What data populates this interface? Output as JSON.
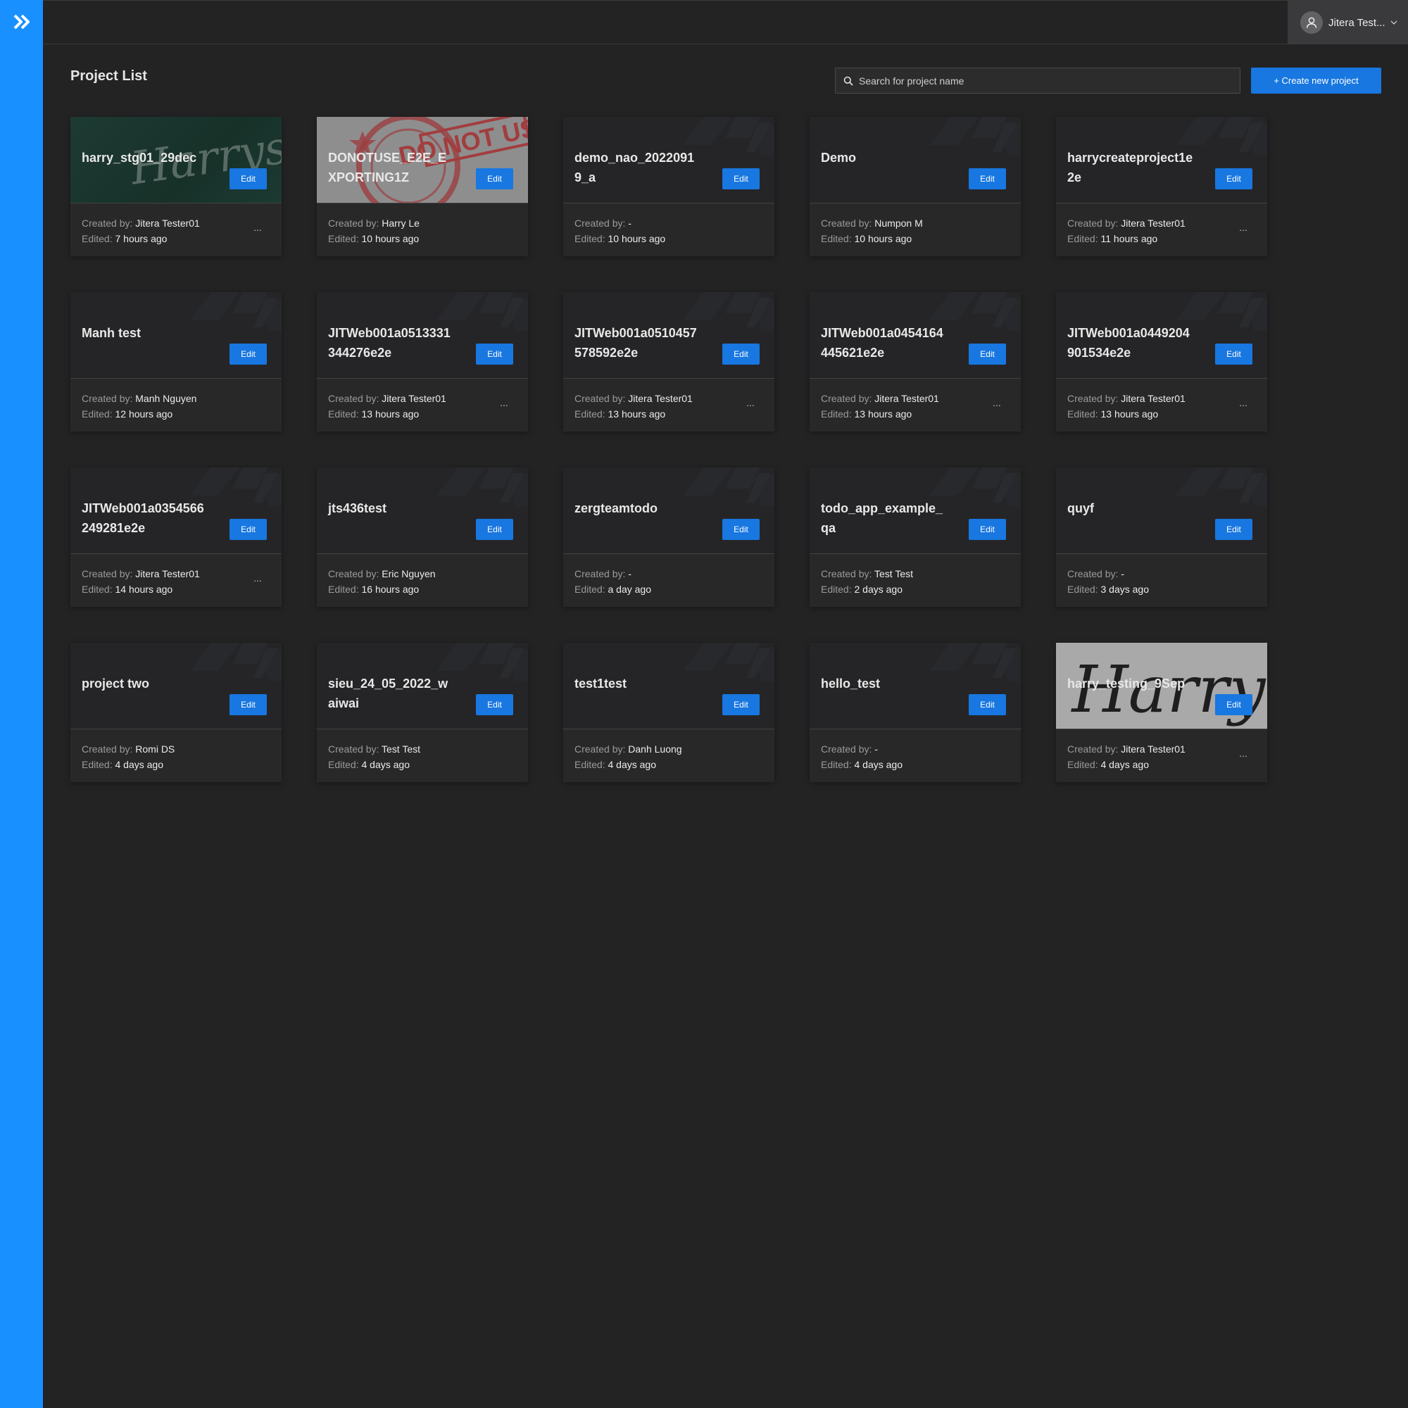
{
  "header": {
    "user_name": "Jitera Test...",
    "accent": "#1890ff"
  },
  "main": {
    "title": "Project List",
    "search_placeholder": "Search for project name",
    "create_label": "+ Create new project"
  },
  "card_labels": {
    "created_by": "Created by:",
    "edited": "Edited:",
    "edit": "Edit",
    "more": "..."
  },
  "projects": [
    {
      "name": "harry_stg01_29dec",
      "created_by": "Jitera Tester01",
      "edited": "7 hours ago",
      "more": true,
      "image": "harrys"
    },
    {
      "name": "DONOTUSE_E2E_EXPORTING1Z",
      "created_by": "Harry Le",
      "edited": "10 hours ago",
      "more": false,
      "image": "donotuse"
    },
    {
      "name": "demo_nao_20220919_a",
      "created_by": "-",
      "edited": "10 hours ago",
      "more": false,
      "image": ""
    },
    {
      "name": "Demo",
      "created_by": "Numpon M",
      "edited": "10 hours ago",
      "more": false,
      "image": ""
    },
    {
      "name": "harrycreateproject1e2e",
      "created_by": "Jitera Tester01",
      "edited": "11 hours ago",
      "more": true,
      "image": ""
    },
    {
      "name": "Manh test",
      "created_by": "Manh Nguyen",
      "edited": "12 hours ago",
      "more": false,
      "image": ""
    },
    {
      "name": "JITWeb001a0513331344276e2e",
      "created_by": "Jitera Tester01",
      "edited": "13 hours ago",
      "more": true,
      "image": ""
    },
    {
      "name": "JITWeb001a0510457578592e2e",
      "created_by": "Jitera Tester01",
      "edited": "13 hours ago",
      "more": true,
      "image": ""
    },
    {
      "name": "JITWeb001a0454164445621e2e",
      "created_by": "Jitera Tester01",
      "edited": "13 hours ago",
      "more": true,
      "image": ""
    },
    {
      "name": "JITWeb001a0449204901534e2e",
      "created_by": "Jitera Tester01",
      "edited": "13 hours ago",
      "more": true,
      "image": ""
    },
    {
      "name": "JITWeb001a0354566249281e2e",
      "created_by": "Jitera Tester01",
      "edited": "14 hours ago",
      "more": true,
      "image": ""
    },
    {
      "name": "jts436test",
      "created_by": "Eric Nguyen",
      "edited": "16 hours ago",
      "more": false,
      "image": ""
    },
    {
      "name": "zergteamtodo",
      "created_by": "-",
      "edited": "a day ago",
      "more": false,
      "image": ""
    },
    {
      "name": "todo_app_example_qa",
      "created_by": "Test Test",
      "edited": "2 days ago",
      "more": false,
      "image": ""
    },
    {
      "name": "quyf",
      "created_by": "-",
      "edited": "3 days ago",
      "more": false,
      "image": ""
    },
    {
      "name": "project two",
      "created_by": "Romi DS",
      "edited": "4 days ago",
      "more": false,
      "image": ""
    },
    {
      "name": "sieu_24_05_2022_waiwai",
      "created_by": "Test Test",
      "edited": "4 days ago",
      "more": false,
      "image": ""
    },
    {
      "name": "test1test",
      "created_by": "Danh Luong",
      "edited": "4 days ago",
      "more": false,
      "image": ""
    },
    {
      "name": "hello_test",
      "created_by": "-",
      "edited": "4 days ago",
      "more": false,
      "image": ""
    },
    {
      "name": "harry_testing_9Sep",
      "created_by": "Jitera Tester01",
      "edited": "4 days ago",
      "more": true,
      "image": "harry"
    }
  ],
  "image_text": {
    "harrys": "Harrys",
    "donotuse": "DO NOT USE",
    "harry": "Harry"
  }
}
